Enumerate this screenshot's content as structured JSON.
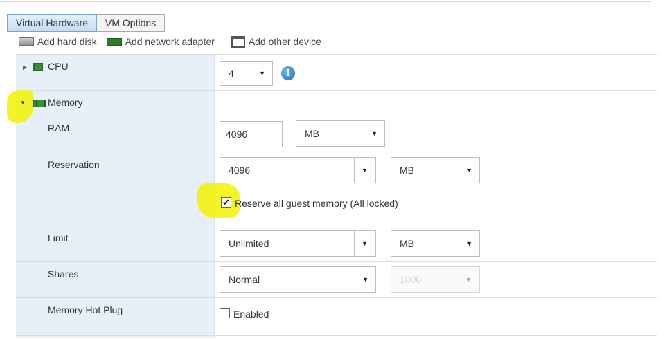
{
  "tabs": [
    {
      "label": "Virtual Hardware",
      "active": true
    },
    {
      "label": "VM Options",
      "active": false
    }
  ],
  "toolbar": {
    "add_hard_disk": "Add hard disk",
    "add_network_adapter": "Add network adapter",
    "add_other_device": "Add other device"
  },
  "cpu": {
    "label": "CPU",
    "value": "4"
  },
  "memory": {
    "label": "Memory",
    "ram": {
      "label": "RAM",
      "value": "4096",
      "unit": "MB"
    },
    "reservation": {
      "label": "Reservation",
      "value": "4096",
      "unit": "MB",
      "reserve_all_label": "Reserve all guest memory (All locked)",
      "reserve_all_checked": true
    },
    "limit": {
      "label": "Limit",
      "value": "Unlimited",
      "unit": "MB"
    },
    "shares": {
      "label": "Shares",
      "value": "Normal",
      "number": "1000"
    },
    "hot_plug": {
      "label": "Memory Hot Plug",
      "enabled_label": "Enabled",
      "enabled_checked": false
    }
  },
  "icons": {
    "caret": "▼",
    "collapsed": "▶",
    "expanded": "▼",
    "check": "✔",
    "info": "i"
  },
  "colors": {
    "left_column_bg": "#e7f0f8",
    "highlight": "#f2f200",
    "active_tab": "#c7dcf1"
  }
}
